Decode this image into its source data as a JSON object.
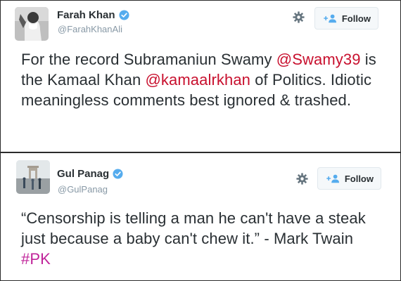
{
  "tweets": [
    {
      "author": {
        "name": "Farah Khan",
        "handle": "@FarahKhanAli",
        "verified": true
      },
      "follow_label": "Follow",
      "text": {
        "part1": "For the record Subramaniun Swamy ",
        "mention1": "@Swamy39",
        "part2": " is the Kamaal Khan ",
        "mention2": "@kamaalrkhan",
        "part3": " of Politics. Idiotic meaningless comments best ignored & trashed."
      }
    },
    {
      "author": {
        "name": "Gul Panag",
        "handle": "@GulPanag",
        "verified": true
      },
      "follow_label": "Follow",
      "text": {
        "part1": "“Censorship is telling a man he can't have a steak just because a baby can't chew it.” - Mark Twain ",
        "hashtag": "#PK"
      }
    }
  ],
  "icons": {
    "verified": "verified-badge-icon",
    "gear": "gear-icon",
    "follow": "follow-person-plus-icon"
  },
  "colors": {
    "mention": "#c8102e",
    "hashtag": "#c0249a",
    "verified_blue": "#55acee",
    "follow_blue": "#55acee"
  }
}
